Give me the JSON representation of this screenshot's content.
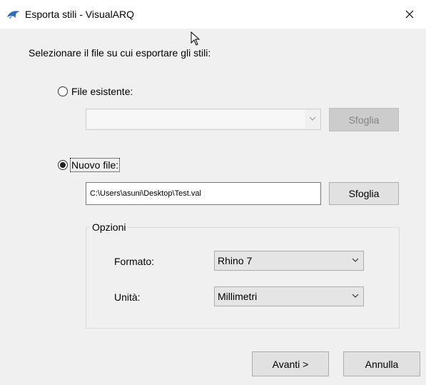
{
  "window": {
    "title": "Esporta stili - VisualARQ"
  },
  "dialog": {
    "prompt": "Selezionare il file su cui esportare gli stili:",
    "existing_file": {
      "label": "File esistente:",
      "selected": false,
      "combo_value": "",
      "browse_label": "Sfoglia",
      "enabled": false
    },
    "new_file": {
      "label": "Nuovo file:",
      "selected": true,
      "path": "C:\\Users\\asuni\\Desktop\\Test.val",
      "browse_label": "Sfoglia"
    },
    "options": {
      "group_label": "Opzioni",
      "format_label": "Formato:",
      "format_value": "Rhino 7",
      "units_label": "Unità:",
      "units_value": "Millimetri"
    },
    "buttons": {
      "next": "Avanti >",
      "cancel": "Annulla"
    }
  },
  "colors": {
    "dialog_bg": "#f0f0f0",
    "titlebar_bg": "#ffffff",
    "app_icon": "#2f6db3"
  }
}
